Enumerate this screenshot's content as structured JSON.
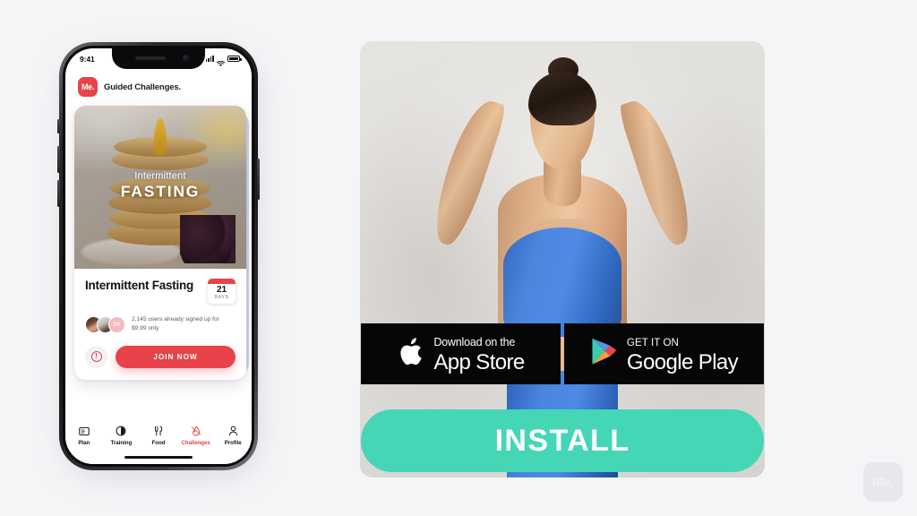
{
  "page": {
    "background_color": "#f4f5f7"
  },
  "phone": {
    "status_bar": {
      "time": "9:41",
      "signal_icon": "cellular-signal-icon",
      "wifi_icon": "wifi-icon",
      "battery_icon": "battery-icon"
    },
    "app_header": {
      "logo_text": "Me.",
      "title": "Guided Challenges."
    },
    "card": {
      "hero": {
        "kicker": "Intermittent",
        "title": "FASTING",
        "image_description": "pancake-stack-photo"
      },
      "title": "Intermittent Fasting",
      "day_badge": {
        "number": "21",
        "label": "DAYS"
      },
      "social_proof": {
        "avatar_count_label": "2K",
        "text": "2,145 users already signed up for $9.99 only"
      },
      "info_button_glyph": "!",
      "join_button_label": "JOIN NOW"
    },
    "tabs": [
      {
        "label": "Plan",
        "icon": "plan-icon",
        "active": false
      },
      {
        "label": "Training",
        "icon": "training-icon",
        "active": false
      },
      {
        "label": "Food",
        "icon": "food-icon",
        "active": false
      },
      {
        "label": "Challenges",
        "icon": "challenges-icon",
        "active": true
      },
      {
        "label": "Profile",
        "icon": "profile-icon",
        "active": false
      }
    ]
  },
  "ad": {
    "hero_image_description": "fitness-model-blue-sportswear-photo",
    "app_store_badge": {
      "small_text": "Download on the",
      "large_text": "App Store",
      "icon": "apple-logo-icon"
    },
    "google_play_badge": {
      "small_text": "GET IT ON",
      "large_text": "Google Play",
      "icon": "google-play-triangle-icon"
    },
    "install_button_label": "INSTALL"
  },
  "watermark": {
    "text": "Me."
  },
  "colors": {
    "brand_red": "#e8434a",
    "install_teal": "#45d6b6",
    "ad_panel_bg": "#e3e1de",
    "page_bg": "#f4f5f7",
    "avatar_badge_pink": "#f7b9bd"
  }
}
